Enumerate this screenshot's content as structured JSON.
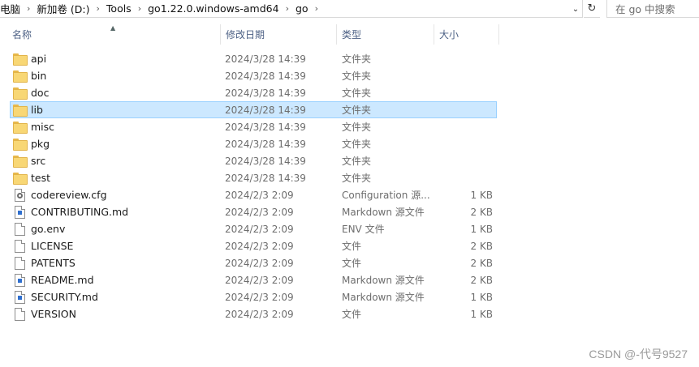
{
  "address": {
    "crumbs": [
      "电脑",
      "新加卷 (D:)",
      "Tools",
      "go1.22.0.windows-amd64",
      "go"
    ],
    "search_placeholder": "在 go 中搜索"
  },
  "columns": {
    "name": "名称",
    "date": "修改日期",
    "type": "类型",
    "size": "大小"
  },
  "files": [
    {
      "name": "api",
      "date": "2024/3/28 14:39",
      "type": "文件夹",
      "size": "",
      "icon": "folder-icon"
    },
    {
      "name": "bin",
      "date": "2024/3/28 14:39",
      "type": "文件夹",
      "size": "",
      "icon": "folder-icon"
    },
    {
      "name": "doc",
      "date": "2024/3/28 14:39",
      "type": "文件夹",
      "size": "",
      "icon": "folder-icon"
    },
    {
      "name": "lib",
      "date": "2024/3/28 14:39",
      "type": "文件夹",
      "size": "",
      "icon": "folder-icon",
      "selected": true
    },
    {
      "name": "misc",
      "date": "2024/3/28 14:39",
      "type": "文件夹",
      "size": "",
      "icon": "folder-icon"
    },
    {
      "name": "pkg",
      "date": "2024/3/28 14:39",
      "type": "文件夹",
      "size": "",
      "icon": "folder-icon"
    },
    {
      "name": "src",
      "date": "2024/3/28 14:39",
      "type": "文件夹",
      "size": "",
      "icon": "folder-icon"
    },
    {
      "name": "test",
      "date": "2024/3/28 14:39",
      "type": "文件夹",
      "size": "",
      "icon": "folder-icon"
    },
    {
      "name": "codereview.cfg",
      "date": "2024/2/3 2:09",
      "type": "Configuration 源...",
      "size": "1 KB",
      "icon": "config-file-icon"
    },
    {
      "name": "CONTRIBUTING.md",
      "date": "2024/2/3 2:09",
      "type": "Markdown 源文件",
      "size": "2 KB",
      "icon": "markdown-file-icon"
    },
    {
      "name": "go.env",
      "date": "2024/2/3 2:09",
      "type": "ENV 文件",
      "size": "1 KB",
      "icon": "file-icon"
    },
    {
      "name": "LICENSE",
      "date": "2024/2/3 2:09",
      "type": "文件",
      "size": "2 KB",
      "icon": "file-icon"
    },
    {
      "name": "PATENTS",
      "date": "2024/2/3 2:09",
      "type": "文件",
      "size": "2 KB",
      "icon": "file-icon"
    },
    {
      "name": "README.md",
      "date": "2024/2/3 2:09",
      "type": "Markdown 源文件",
      "size": "2 KB",
      "icon": "markdown-file-icon"
    },
    {
      "name": "SECURITY.md",
      "date": "2024/2/3 2:09",
      "type": "Markdown 源文件",
      "size": "1 KB",
      "icon": "markdown-file-icon"
    },
    {
      "name": "VERSION",
      "date": "2024/2/3 2:09",
      "type": "文件",
      "size": "1 KB",
      "icon": "file-icon"
    }
  ],
  "watermark": "CSDN @-代号9527",
  "colors": {
    "selection_bg": "#cce8ff",
    "selection_border": "#99d1ff",
    "folder": "#f8d775",
    "header_text": "#4d6185"
  }
}
